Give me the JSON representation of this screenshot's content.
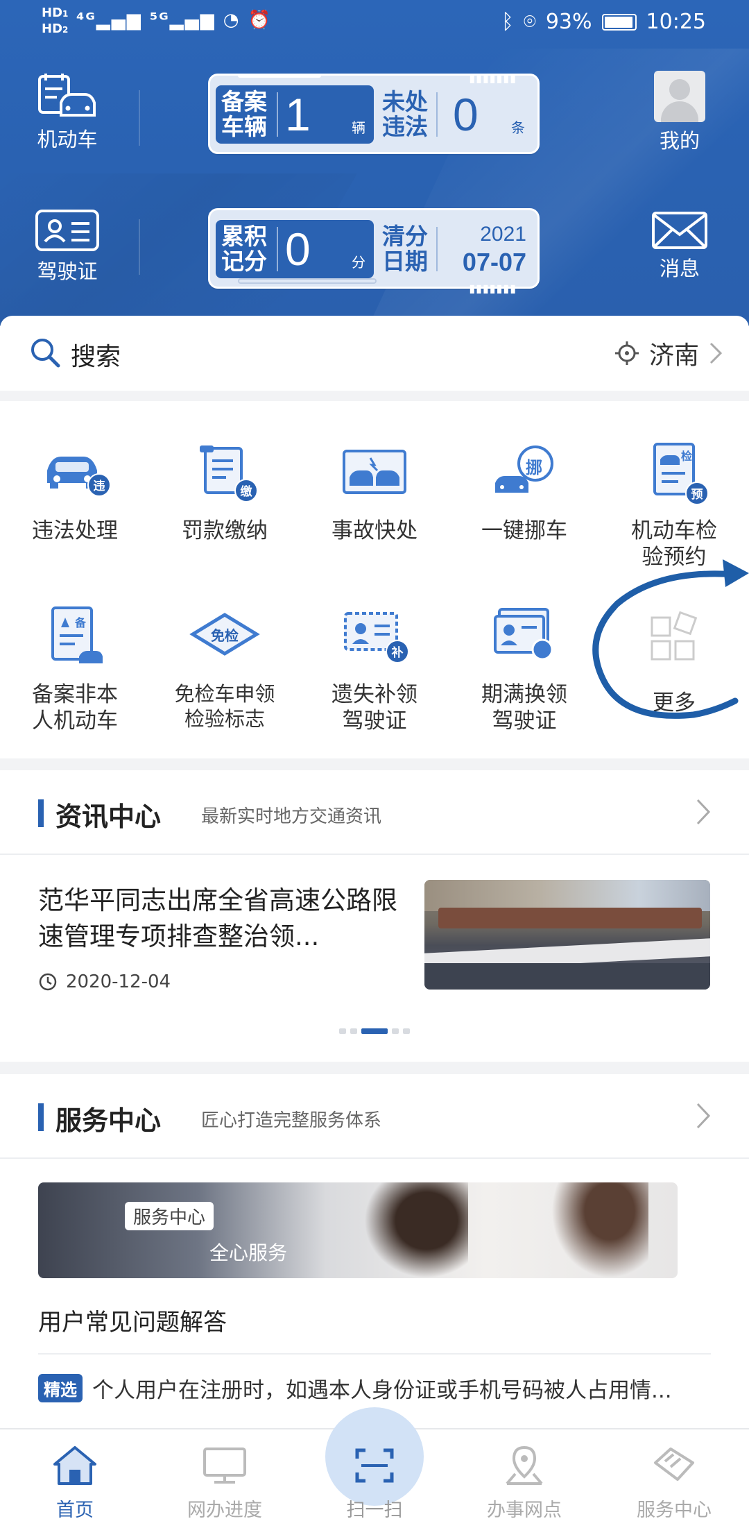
{
  "status_bar": {
    "left": "HD 4G 5G",
    "battery": "93%",
    "time": "10:25"
  },
  "header": {
    "vehicle_label": "机动车",
    "license_label": "驾驶证",
    "profile_label": "我的",
    "message_label": "消息",
    "card1": {
      "a_title": "备案车辆",
      "a_value": "1",
      "a_unit": "辆",
      "b_title": "未处违法",
      "b_value": "0",
      "b_unit": "条"
    },
    "card2": {
      "a_title": "累积记分",
      "a_value": "0",
      "a_unit": "分",
      "b_title": "清分日期",
      "b_year": "2021",
      "b_date": "07-07"
    }
  },
  "search": {
    "placeholder": "搜索",
    "city": "济南"
  },
  "services": [
    {
      "label": "违法处理",
      "badge": "违"
    },
    {
      "label": "罚款缴纳",
      "badge": "缴"
    },
    {
      "label": "事故快处"
    },
    {
      "label": "一键挪车",
      "badge": "挪"
    },
    {
      "label": "机动车检验预约",
      "badge": "预",
      "top_badge": "检"
    },
    {
      "label": "备案非本人机动车",
      "top_badge": "备"
    },
    {
      "label": "免检车申领检验标志",
      "badge": "免检"
    },
    {
      "label": "遗失补领驾驶证",
      "badge": "补"
    },
    {
      "label": "期满换领驾驶证"
    },
    {
      "label": "更多"
    }
  ],
  "info_center": {
    "title": "资讯中心",
    "subtitle": "最新实时地方交通资讯",
    "news_title": "范华平同志出席全省高速公路限速管理专项排查整治领...",
    "news_date": "2020-12-04"
  },
  "service_center": {
    "title": "服务中心",
    "subtitle": "匠心打造完整服务体系",
    "banner_tag": "服务中心",
    "banner_text": "全心服务",
    "faq_title": "用户常见问题解答",
    "faq_badge": "精选",
    "faq_item": "个人用户在注册时，如遇本人身份证或手机号码被人占用情..."
  },
  "bottom_nav": [
    {
      "label": "首页",
      "icon": "home-icon",
      "active": true
    },
    {
      "label": "网办进度",
      "icon": "monitor-icon"
    },
    {
      "label": "扫一扫",
      "icon": "scan-icon"
    },
    {
      "label": "办事网点",
      "icon": "map-pin-icon"
    },
    {
      "label": "服务中心",
      "icon": "service-icon"
    }
  ],
  "colors": {
    "brand_blue": "#2a62b2",
    "header_bg": "#2c66b8",
    "card_bg": "#dfe8f5"
  }
}
